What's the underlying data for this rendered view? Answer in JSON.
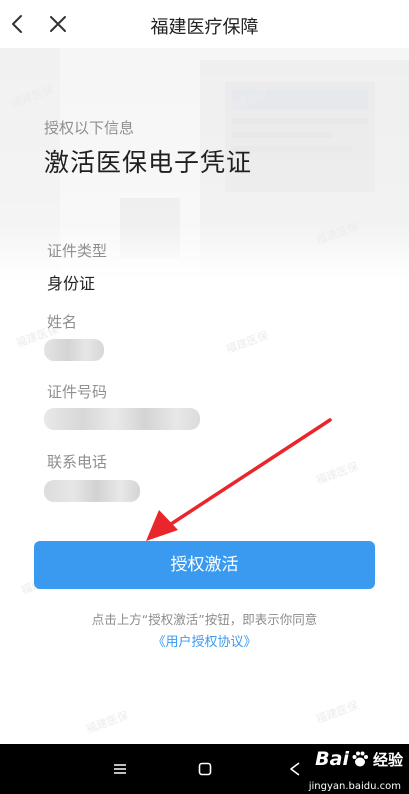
{
  "header": {
    "title": "福建医疗保障",
    "back_icon": "chevron-left-icon",
    "close_icon": "close-icon"
  },
  "intro": {
    "subtitle": "授权以下信息",
    "heading": "激活医保电子凭证"
  },
  "fields": [
    {
      "label": "证件类型",
      "value": "身份证"
    },
    {
      "label": "姓名",
      "value": ""
    },
    {
      "label": "证件号码",
      "value": ""
    },
    {
      "label": "联系电话",
      "value": ""
    }
  ],
  "activate_button": {
    "label": "授权激活",
    "color": "#3a9af0"
  },
  "consent": {
    "note": "点击上方“授权激活”按钮，即表示你同意",
    "agreement_link": "《用户授权协议》"
  },
  "watermark_text": "福建医保",
  "navbar": {
    "menu_icon": "menu-icon",
    "home_icon": "square-home-icon",
    "back_icon": "back-triangle-icon"
  },
  "brand_watermark": {
    "name": "Bai",
    "product": "经验",
    "url": "jingyan.baidu.com"
  },
  "annotation": {
    "arrow_color": "#e8262b"
  }
}
